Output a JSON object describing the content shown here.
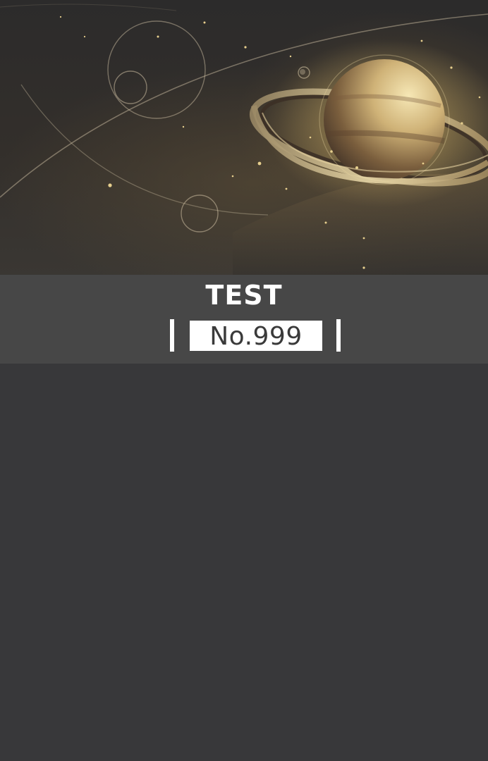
{
  "banner": {
    "illustration": "ringed-planet-space-illustration",
    "colors": {
      "background": "#2c2b2b",
      "gold": "#d6bb7e",
      "band": "#474747",
      "page": "#38383a"
    }
  },
  "header": {
    "title": "TEST",
    "number_label": "No.999"
  }
}
